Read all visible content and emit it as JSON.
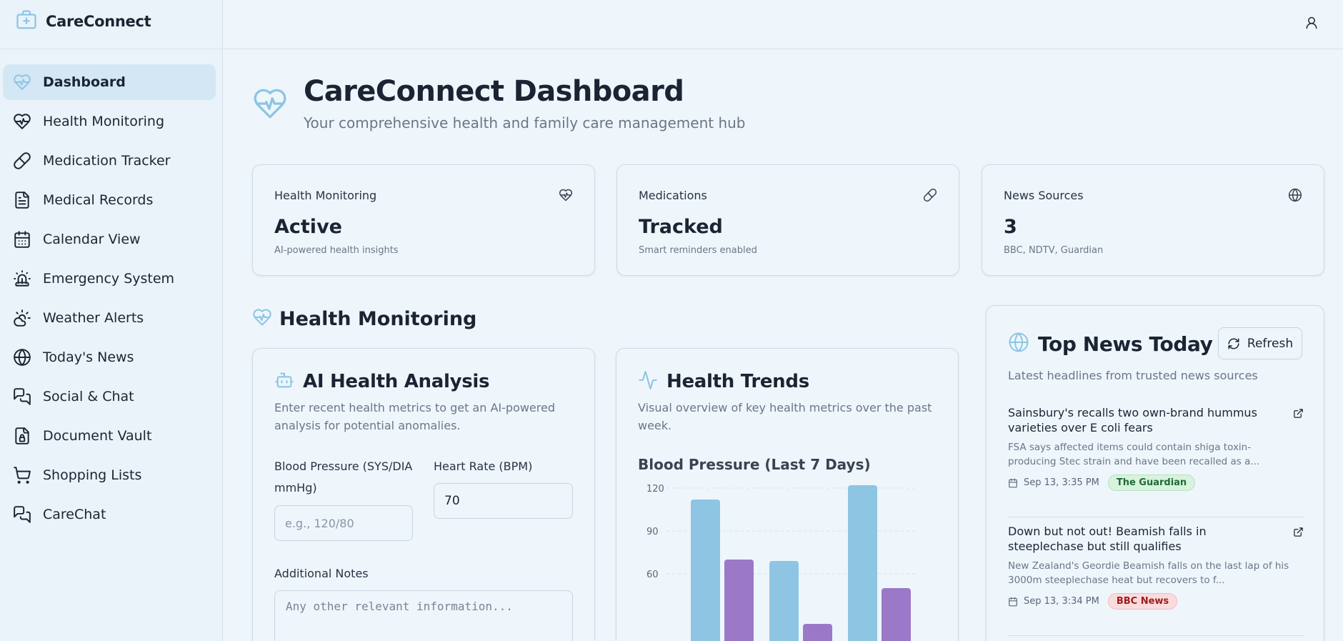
{
  "app": {
    "name": "CareConnect"
  },
  "sidebar": {
    "items": [
      {
        "label": "Dashboard",
        "icon": "heart-pulse-icon",
        "active": true
      },
      {
        "label": "Health Monitoring",
        "icon": "heart-pulse-icon"
      },
      {
        "label": "Medication Tracker",
        "icon": "pill-icon"
      },
      {
        "label": "Medical Records",
        "icon": "file-text-icon"
      },
      {
        "label": "Calendar View",
        "icon": "calendar-icon"
      },
      {
        "label": "Emergency System",
        "icon": "siren-icon"
      },
      {
        "label": "Weather Alerts",
        "icon": "cloud-sun-icon"
      },
      {
        "label": "Today's News",
        "icon": "globe-icon"
      },
      {
        "label": "Social & Chat",
        "icon": "messages-icon"
      },
      {
        "label": "Document Vault",
        "icon": "file-lock-icon"
      },
      {
        "label": "Shopping Lists",
        "icon": "cart-icon"
      },
      {
        "label": "CareChat",
        "icon": "messages-icon"
      }
    ]
  },
  "header": {
    "title": "CareConnect Dashboard",
    "subtitle": "Your comprehensive health and family care management hub"
  },
  "stats": [
    {
      "label": "Health Monitoring",
      "value": "Active",
      "note": "AI-powered health insights",
      "icon": "heart-pulse-icon"
    },
    {
      "label": "Medications",
      "value": "Tracked",
      "note": "Smart reminders enabled",
      "icon": "pill-icon"
    },
    {
      "label": "News Sources",
      "value": "3",
      "note": "BBC, NDTV, Guardian",
      "icon": "globe-icon"
    }
  ],
  "health_section": {
    "title": "Health Monitoring"
  },
  "ai_analysis": {
    "title": "AI Health Analysis",
    "description": "Enter recent health metrics to get an AI-powered analysis for potential anomalies.",
    "bp_label": "Blood Pressure (SYS/DIA mmHg)",
    "bp_placeholder": "e.g., 120/80",
    "bp_value": "",
    "hr_label": "Heart Rate (BPM)",
    "hr_value": "70",
    "notes_label": "Additional Notes",
    "notes_placeholder": "Any other relevant information..."
  },
  "trends": {
    "title": "Health Trends",
    "description": "Visual overview of key health metrics over the past week."
  },
  "chart_data": {
    "type": "bar",
    "title": "Blood Pressure (Last 7 Days)",
    "yticks": [
      120,
      90,
      60
    ],
    "ylim": [
      0,
      125
    ],
    "grid": true,
    "series": [
      {
        "values": [
          112,
          69,
          122
        ],
        "color": "#8ec5e3"
      },
      {
        "values": [
          70,
          25,
          50
        ],
        "color": "#9c78c9"
      }
    ]
  },
  "news": {
    "title": "Top News Today",
    "subtitle": "Latest headlines from trusted news sources",
    "refresh_label": "Refresh",
    "items": [
      {
        "headline": "Sainsbury's recalls two own-brand hummus varieties over E coli fears",
        "summary": "FSA says affected items could contain shiga toxin-producing Stec strain and have been recalled as a...",
        "time": "Sep 13, 3:35 PM",
        "source": "The Guardian",
        "source_color": "green"
      },
      {
        "headline": "Down but not out! Beamish falls in steeplechase but still qualifies",
        "summary": "New Zealand's Geordie Beamish falls on the last lap of his 3000m steeplechase heat but recovers to f...",
        "time": "Sep 13, 3:34 PM",
        "source": "BBC News",
        "source_color": "red"
      }
    ]
  },
  "colors": {
    "accent": "#8ec5e3",
    "secondary": "#9c78c9",
    "background": "#eef6fc",
    "active_nav": "#d3e7f5"
  }
}
